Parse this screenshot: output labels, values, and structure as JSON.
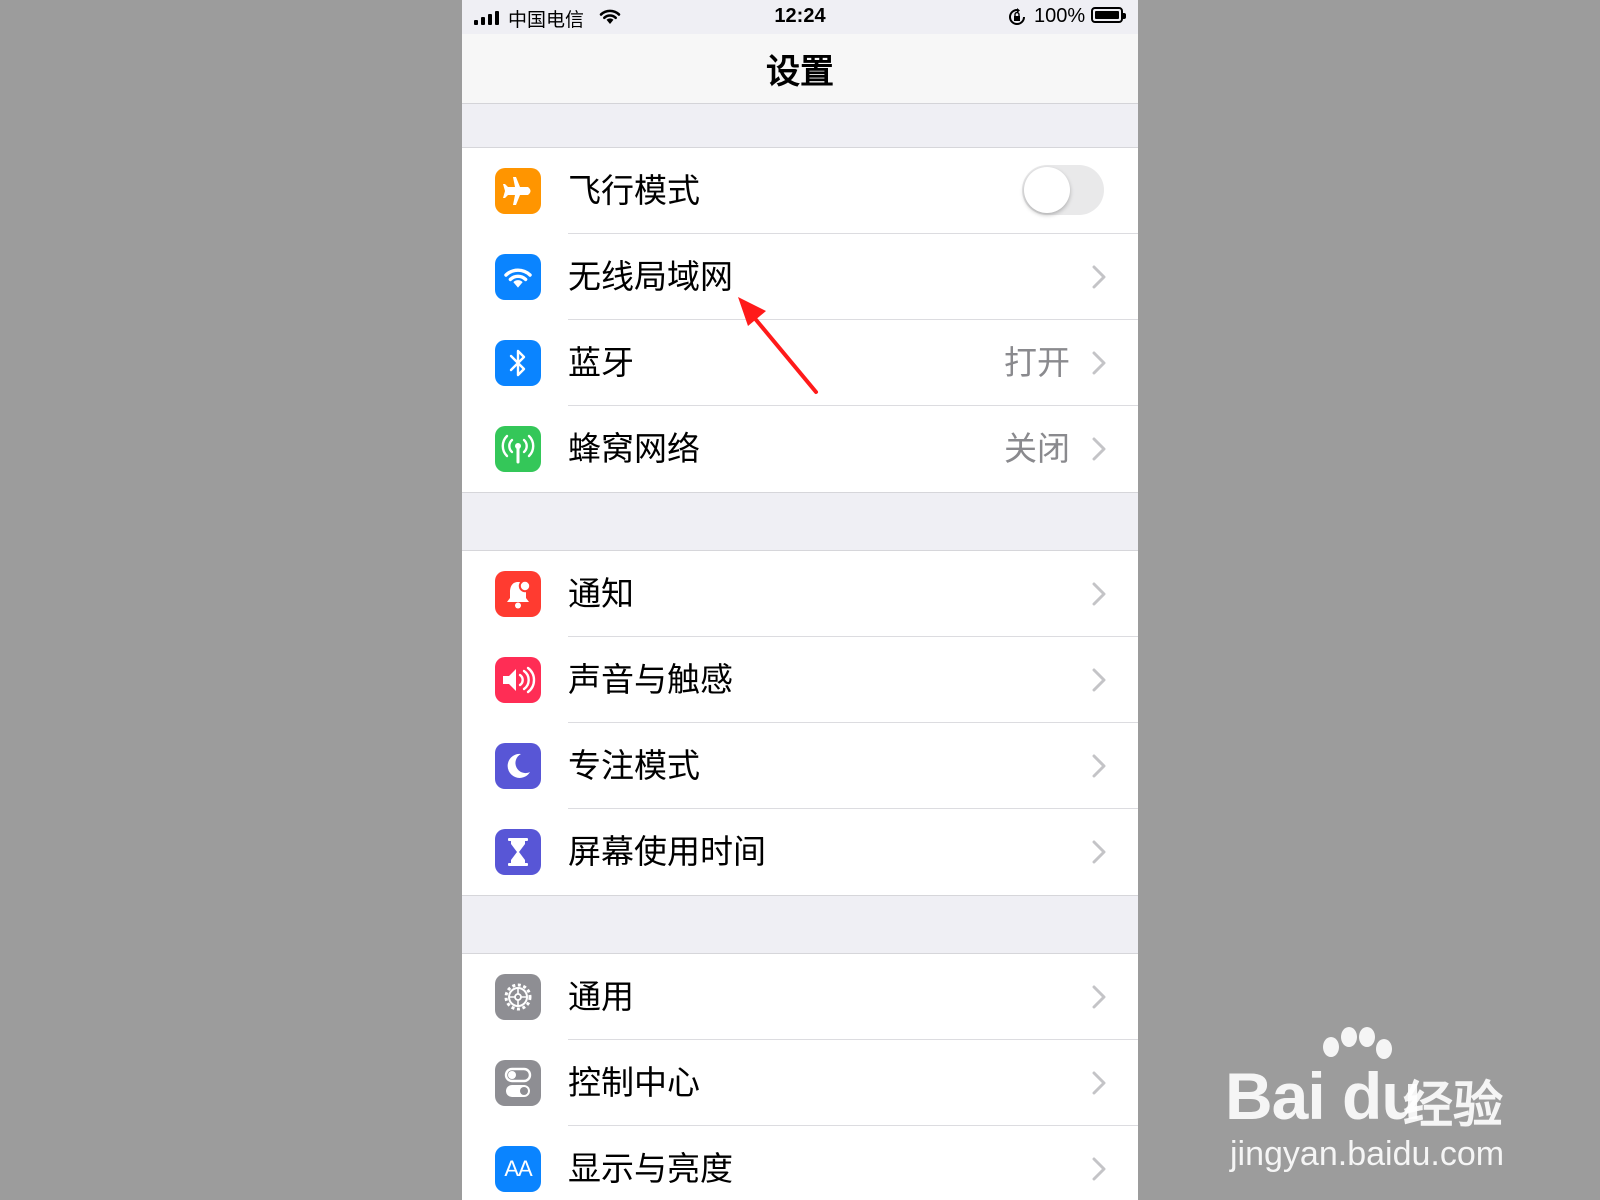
{
  "status_bar": {
    "carrier": "中国电信",
    "time": "12:24",
    "battery_percent": "100%"
  },
  "nav": {
    "title": "设置"
  },
  "groups": [
    {
      "items": [
        {
          "label": "飞行模式",
          "icon": "airplane-icon",
          "color": "#ff9500",
          "control": "toggle",
          "toggle_on": false
        },
        {
          "label": "无线局域网",
          "icon": "wifi-icon",
          "color": "#0a84ff",
          "value": ""
        },
        {
          "label": "蓝牙",
          "icon": "bluetooth-icon",
          "color": "#0a84ff",
          "value": "打开"
        },
        {
          "label": "蜂窝网络",
          "icon": "cellular-antenna-icon",
          "color": "#34c759",
          "value": "关闭"
        }
      ]
    },
    {
      "items": [
        {
          "label": "通知",
          "icon": "bell-icon",
          "color": "#ff3b30"
        },
        {
          "label": "声音与触感",
          "icon": "speaker-icon",
          "color": "#ff2d55"
        },
        {
          "label": "专注模式",
          "icon": "moon-icon",
          "color": "#5856d6"
        },
        {
          "label": "屏幕使用时间",
          "icon": "hourglass-icon",
          "color": "#5856d6"
        }
      ]
    },
    {
      "items": [
        {
          "label": "通用",
          "icon": "gear-icon",
          "color": "#8e8e93"
        },
        {
          "label": "控制中心",
          "icon": "switches-icon",
          "color": "#8e8e93"
        },
        {
          "label": "显示与亮度",
          "icon": "text-size-icon",
          "color": "#0a84ff",
          "icon_text": "AA"
        }
      ]
    }
  ],
  "watermark": {
    "brand": "Bai  du",
    "product": "经验",
    "url": "jingyan.baidu.com"
  },
  "annotation": {
    "arrow_color": "#ff1a1a"
  }
}
